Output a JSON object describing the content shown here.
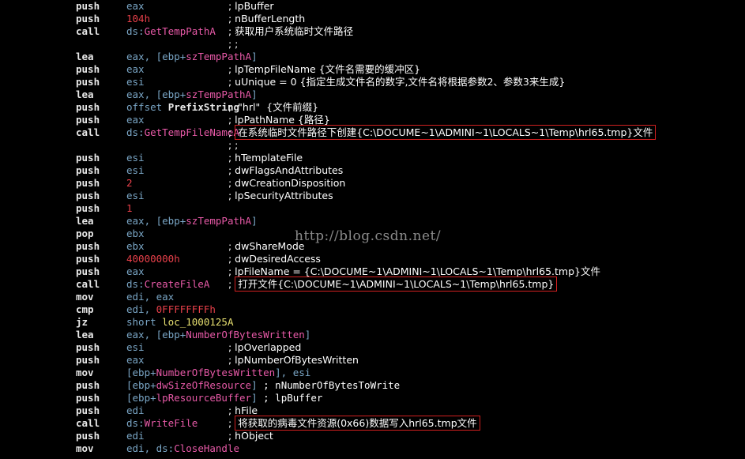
{
  "rows": [
    {
      "mnemonic": "push",
      "operand": "eax",
      "comment": "; lpBuffer"
    },
    {
      "mnemonic": "push",
      "operand": "104h",
      "operand_kind": "num",
      "comment": "; nBufferLength"
    },
    {
      "mnemonic": "call",
      "operand_prefix": "ds:",
      "operand": "GetTempPathA",
      "operand_kind": "sym",
      "comment": "; 获取用户系统临时文件路径"
    },
    {
      "mnemonic": "",
      "operand": "",
      "comment": "; ;"
    },
    {
      "mnemonic": "lea",
      "operand": "eax, [ebp+szTempPathA]",
      "operand_kind": "mem",
      "mem_reg": "eax, [ebp+",
      "mem_sym": "szTempPathA",
      "mem_tail": "]"
    },
    {
      "mnemonic": "push",
      "operand": "eax",
      "comment": "; lpTempFileName {文件名需要的缓冲区}"
    },
    {
      "mnemonic": "push",
      "operand": "esi",
      "comment": "; uUnique = 0 {指定生成文件名的数字,文件名将根据参数2、参数3来生成}"
    },
    {
      "mnemonic": "lea",
      "operand": "eax, [ebp+szTempPathA]",
      "operand_kind": "mem",
      "mem_reg": "eax, [ebp+",
      "mem_sym": "szTempPathA",
      "mem_tail": "]"
    },
    {
      "mnemonic": "push",
      "operand": "offset PrefixString",
      "operand_kind": "offset",
      "comment": ";  \"hrl\"  {文件前缀}"
    },
    {
      "mnemonic": "push",
      "operand": "eax",
      "comment": "; lpPathName {路径}"
    },
    {
      "mnemonic": "call",
      "operand_prefix": "ds:",
      "operand": "GetTempFileNameA",
      "operand_kind": "sym",
      "comment": "; ",
      "boxed": "在系统临时文件路径下创建{C:\\DOCUME~1\\ADMINI~1\\LOCALS~1\\Temp\\hrl65.tmp}文件"
    },
    {
      "mnemonic": "",
      "operand": "",
      "comment": "; ;"
    },
    {
      "mnemonic": "push",
      "operand": "esi",
      "comment": "; hTemplateFile"
    },
    {
      "mnemonic": "push",
      "operand": "esi",
      "comment": "; dwFlagsAndAttributes"
    },
    {
      "mnemonic": "push",
      "operand": "2",
      "operand_kind": "num",
      "comment": "; dwCreationDisposition"
    },
    {
      "mnemonic": "push",
      "operand": "esi",
      "comment": "; lpSecurityAttributes"
    },
    {
      "mnemonic": "push",
      "operand": "1",
      "operand_kind": "num",
      "comment": ""
    },
    {
      "mnemonic": "lea",
      "operand": "eax, [ebp+szTempPathA]",
      "operand_kind": "mem",
      "mem_reg": "eax, [ebp+",
      "mem_sym": "szTempPathA",
      "mem_tail": "]"
    },
    {
      "mnemonic": "pop",
      "operand": "ebx",
      "comment": ""
    },
    {
      "mnemonic": "push",
      "operand": "ebx",
      "comment": "; dwShareMode"
    },
    {
      "mnemonic": "push",
      "operand": "40000000h",
      "operand_kind": "num",
      "comment": "; dwDesiredAccess"
    },
    {
      "mnemonic": "push",
      "operand": "eax",
      "comment": "; lpFileName = {C:\\DOCUME~1\\ADMINI~1\\LOCALS~1\\Temp\\hrl65.tmp}文件"
    },
    {
      "mnemonic": "call",
      "operand_prefix": "ds:",
      "operand": "CreateFileA",
      "operand_kind": "sym",
      "comment": "; ",
      "boxed": "打开文件{C:\\DOCUME~1\\ADMINI~1\\LOCALS~1\\Temp\\hrl65.tmp}"
    },
    {
      "mnemonic": "mov",
      "operand": "edi, eax",
      "comment": ""
    },
    {
      "mnemonic": "cmp",
      "operand": "edi, 0FFFFFFFFh",
      "operand_kind": "regnum",
      "op_reg": "edi, ",
      "op_num": "0FFFFFFFFh",
      "comment": ""
    },
    {
      "mnemonic": "jz",
      "operand": "short loc_1000125A",
      "operand_kind": "short",
      "op_kw": "short ",
      "op_lbl": "loc_1000125A",
      "comment": ""
    },
    {
      "mnemonic": "lea",
      "operand": "eax, [ebp+NumberOfBytesWritten]",
      "operand_kind": "mem",
      "mem_reg": "eax, [ebp+",
      "mem_sym": "NumberOfBytesWritten",
      "mem_tail": "]"
    },
    {
      "mnemonic": "push",
      "operand": "esi",
      "comment": "; lpOverlapped"
    },
    {
      "mnemonic": "push",
      "operand": "eax",
      "comment": "; lpNumberOfBytesWritten"
    },
    {
      "mnemonic": "mov",
      "operand": "[ebp+NumberOfBytesWritten], esi",
      "operand_kind": "mem",
      "mem_reg": "[ebp+",
      "mem_sym": "NumberOfBytesWritten",
      "mem_tail": "], esi"
    },
    {
      "mnemonic": "push",
      "operand": "[ebp+dwSizeOfResource]",
      "operand_kind": "mem",
      "mem_reg": "[ebp+",
      "mem_sym": "dwSizeOfResource",
      "mem_tail": "]",
      "comment": " ; nNumberOfBytesToWrite",
      "comment_inline": true
    },
    {
      "mnemonic": "push",
      "operand": "[ebp+lpResourceBuffer]",
      "operand_kind": "mem",
      "mem_reg": "[ebp+",
      "mem_sym": "lpResourceBuffer",
      "mem_tail": "]",
      "comment": " ; lpBuffer",
      "comment_inline": true
    },
    {
      "mnemonic": "push",
      "operand": "edi",
      "comment": "; hFile"
    },
    {
      "mnemonic": "call",
      "operand_prefix": "ds:",
      "operand": "WriteFile",
      "operand_kind": "sym",
      "comment": "; ",
      "boxed": "将获取的病毒文件资源(0x66)数据写入hrl65.tmp文件"
    },
    {
      "mnemonic": "push",
      "operand": "edi",
      "comment": "; hObject"
    },
    {
      "mnemonic": "mov",
      "operand_prefix": "edi, ds:",
      "operand": "CloseHandle",
      "operand_kind": "sym",
      "comment": ""
    }
  ],
  "watermark": "http://blog.csdn.net/",
  "colors": {
    "background": "#000000",
    "mnemonic": "#e8e8e8",
    "register": "#7aa6c6",
    "number": "#e8404a",
    "symbol": "#e85aa8",
    "label": "#e8e070",
    "comment": "#ffffff",
    "highlight_box": "#d12020"
  }
}
